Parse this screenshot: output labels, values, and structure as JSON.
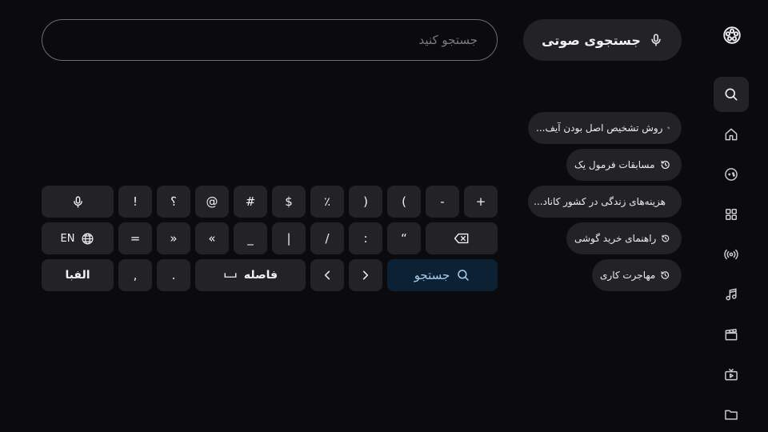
{
  "search": {
    "placeholder": "جستجو کنید",
    "voice_label": "جستجوی صوتی"
  },
  "sidebar": {
    "logo_icon": "film-reel-icon",
    "items": [
      {
        "id": "search",
        "icon": "search-icon",
        "active": true
      },
      {
        "id": "home",
        "icon": "home-icon",
        "active": false
      },
      {
        "id": "games",
        "icon": "gamepad-icon",
        "active": false
      },
      {
        "id": "apps",
        "icon": "apps-grid-icon",
        "active": false
      },
      {
        "id": "live",
        "icon": "broadcast-icon",
        "active": false
      },
      {
        "id": "music",
        "icon": "music-note-icon",
        "active": false
      },
      {
        "id": "movies",
        "icon": "clapperboard-icon",
        "active": false
      },
      {
        "id": "tv",
        "icon": "tv-play-icon",
        "active": false
      },
      {
        "id": "files",
        "icon": "folder-icon",
        "active": false
      }
    ]
  },
  "history": [
    "روش تشخیص اصل بودن آیف...",
    "مسابقات فرمول یک",
    "هزینه‌های زندگی در کشور کاناد...",
    "راهنمای خرید گوشی",
    "مهاجرت کاری"
  ],
  "keyboard": {
    "row1": [
      "+",
      "-",
      "(",
      ")",
      "٪",
      "$",
      "#",
      "@",
      "؟",
      "!"
    ],
    "row2": [
      "“",
      ":",
      "/",
      "|",
      "_",
      "«",
      "»",
      "="
    ],
    "lang_label": "EN",
    "space_label": "فاصله",
    "search_label": "جستجو",
    "dot_label": ".",
    "comma_label": ",",
    "alphabet_label": "الفبا"
  },
  "colors": {
    "background": "#0b0b0d",
    "surface": "#232327",
    "search_key_bg": "#0c2133",
    "search_key_fg": "#a9cdec"
  }
}
